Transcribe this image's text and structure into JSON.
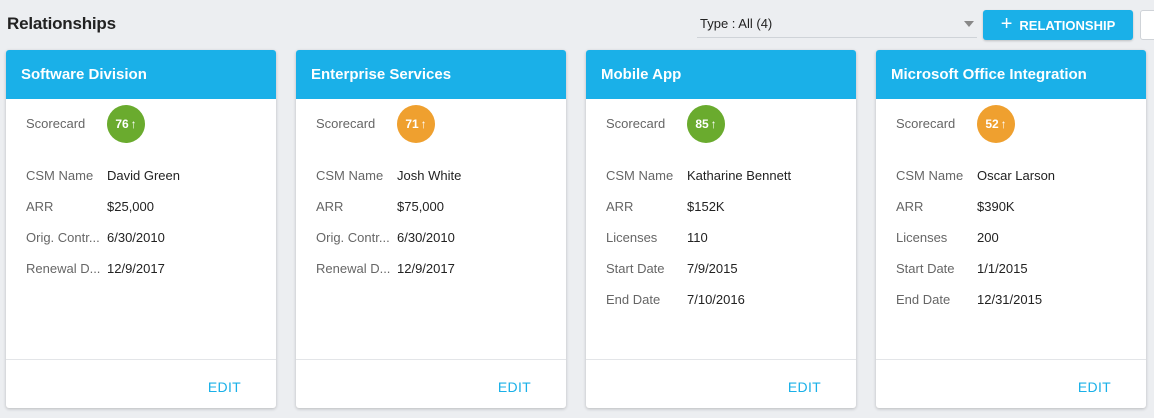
{
  "header": {
    "title": "Relationships",
    "type_filter": "Type : All (4)",
    "add_button_label": "RELATIONSHIP"
  },
  "colors": {
    "accent": "#1ab0e8",
    "score_green": "#6aab2e",
    "score_orange": "#efa02f"
  },
  "cards": [
    {
      "title": "Software Division",
      "scorecard_label": "Scorecard",
      "score": "76",
      "score_color": "#6aab2e",
      "fields": [
        {
          "label": "CSM Name",
          "value": "David Green"
        },
        {
          "label": "ARR",
          "value": "$25,000"
        },
        {
          "label": "Orig. Contr...",
          "value": "6/30/2010"
        },
        {
          "label": "Renewal D...",
          "value": "12/9/2017"
        }
      ],
      "edit_label": "EDIT"
    },
    {
      "title": "Enterprise Services",
      "scorecard_label": "Scorecard",
      "score": "71",
      "score_color": "#efa02f",
      "fields": [
        {
          "label": "CSM Name",
          "value": "Josh White"
        },
        {
          "label": "ARR",
          "value": "$75,000"
        },
        {
          "label": "Orig. Contr...",
          "value": "6/30/2010"
        },
        {
          "label": "Renewal D...",
          "value": "12/9/2017"
        }
      ],
      "edit_label": "EDIT"
    },
    {
      "title": "Mobile App",
      "scorecard_label": "Scorecard",
      "score": "85",
      "score_color": "#6aab2e",
      "fields": [
        {
          "label": "CSM Name",
          "value": "Katharine Bennett"
        },
        {
          "label": "ARR",
          "value": "$152K"
        },
        {
          "label": "Licenses",
          "value": "110"
        },
        {
          "label": "Start Date",
          "value": "7/9/2015"
        },
        {
          "label": "End Date",
          "value": "7/10/2016"
        }
      ],
      "edit_label": "EDIT"
    },
    {
      "title": "Microsoft Office Integration",
      "scorecard_label": "Scorecard",
      "score": "52",
      "score_color": "#efa02f",
      "fields": [
        {
          "label": "CSM Name",
          "value": "Oscar Larson"
        },
        {
          "label": "ARR",
          "value": "$390K"
        },
        {
          "label": "Licenses",
          "value": "200"
        },
        {
          "label": "Start Date",
          "value": "1/1/2015"
        },
        {
          "label": "End Date",
          "value": "12/31/2015"
        }
      ],
      "edit_label": "EDIT"
    }
  ]
}
